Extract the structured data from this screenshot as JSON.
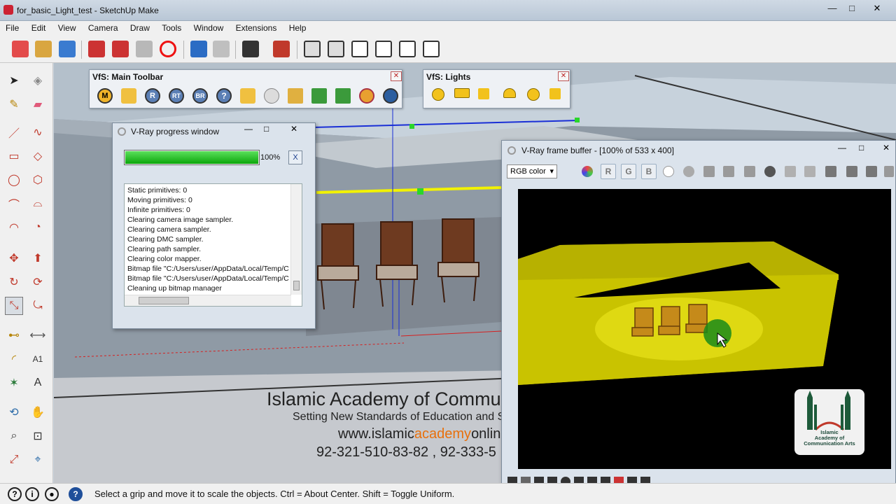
{
  "window": {
    "title": "for_basic_Light_test - SketchUp Make",
    "controls": [
      "—",
      "□",
      "✕"
    ]
  },
  "menu": [
    "File",
    "Edit",
    "View",
    "Camera",
    "Draw",
    "Tools",
    "Window",
    "Extensions",
    "Help"
  ],
  "vfs_main_toolbar": {
    "title": "VfS: Main Toolbar",
    "buttons": [
      "M",
      "",
      "R",
      "RT",
      "BR",
      "?",
      "",
      "",
      "",
      "",
      "",
      "",
      ""
    ]
  },
  "vfs_lights": {
    "title": "VfS: Lights"
  },
  "vray_progress": {
    "title": "V-Ray progress window",
    "percent_label": "100%",
    "percent": 100,
    "cancel_label": "X",
    "log": [
      "Static primitives: 0",
      "Moving primitives: 0",
      "Infinite primitives: 0",
      "Clearing camera image sampler.",
      "Clearing camera sampler.",
      "Clearing DMC sampler.",
      "Clearing path sampler.",
      "Clearing color mapper.",
      "Bitmap file \"C:/Users/user/AppData/Local/Temp/C",
      "Bitmap file \"C:/Users/user/AppData/Local/Temp/C",
      "Cleaning up bitmap manager"
    ]
  },
  "frame_buffer": {
    "title": "V-Ray frame buffer - [100% of 533 x 400]",
    "channel": "RGB color",
    "channel_buttons": [
      "R",
      "G",
      "B"
    ]
  },
  "logo": {
    "text_lines": [
      "Islamic",
      "Academy of",
      "Communication Arts"
    ]
  },
  "academy": {
    "title": "Islamic Academy of Commu",
    "subtitle": "Setting New Standards of Education and S",
    "web_prefix": "www.islamic",
    "web_highlight": "academy",
    "web_suffix": "onlin",
    "phones": "92-321-510-83-82  ,  92-333-5"
  },
  "status": {
    "text": "Select a grip and move it to scale the objects. Ctrl = About Center. Shift = Toggle Uniform."
  }
}
